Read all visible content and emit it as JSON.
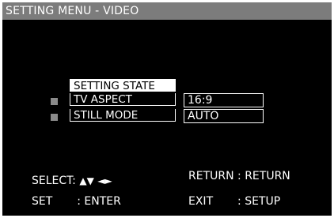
{
  "title": "SETTING MENU - VIDEO",
  "menu": {
    "header": "SETTING STATE",
    "items": [
      {
        "label": "TV ASPECT",
        "value": "16:9"
      },
      {
        "label": "STILL MODE",
        "value": "AUTO"
      }
    ]
  },
  "help": {
    "select_label": "SELECT:",
    "up_arrow": "▲",
    "down_arrow": "▼",
    "left_arrow": "◄",
    "right_arrow": "►",
    "return_key": "RETURN",
    "return_sep": ":",
    "return_action": "RETURN",
    "set_key": "SET",
    "set_sep": ":",
    "set_action": "ENTER",
    "exit_key": "EXIT",
    "exit_sep": ":",
    "exit_action": "SETUP"
  },
  "colors": {
    "background": "#000000",
    "title_bar": "#7c7c7c",
    "text": "#ffffff",
    "bullet": "#8a8a8a"
  }
}
